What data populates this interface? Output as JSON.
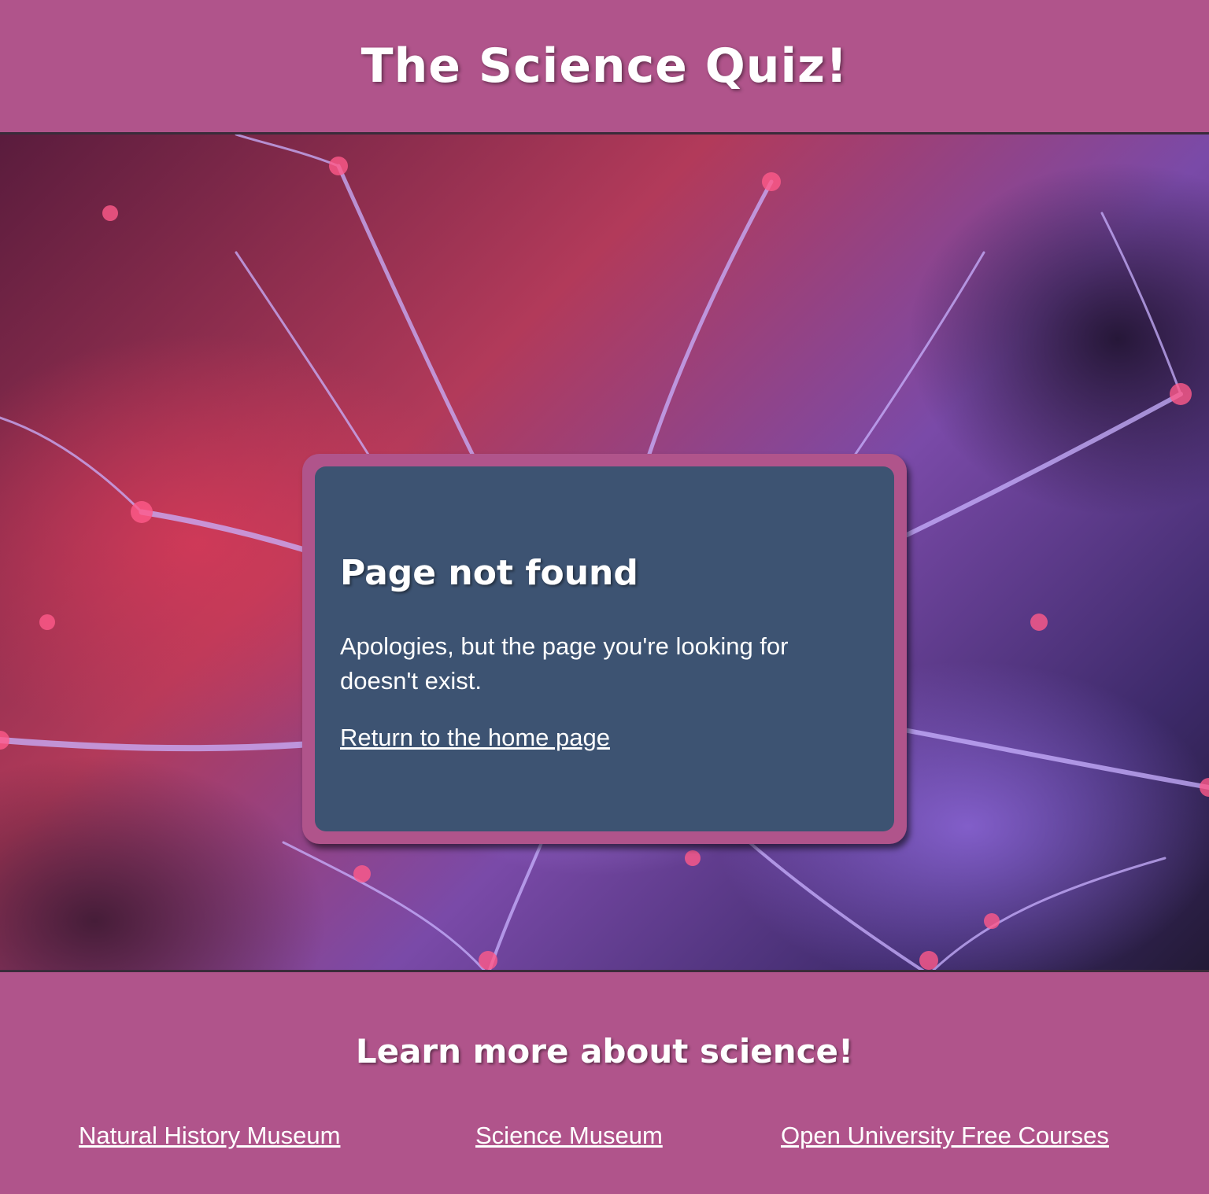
{
  "header": {
    "title": "The Science Quiz!"
  },
  "hero": {
    "image": "plasma-ball-background",
    "colors": {
      "accent": "#b0548b",
      "card": "#3d5372"
    }
  },
  "card": {
    "title": "Page not found",
    "message": "Apologies, but the page you're looking for doesn't exist.",
    "link_label": "Return to the home page"
  },
  "footer": {
    "heading": "Learn more about science!",
    "links": [
      {
        "label": "Natural History Museum"
      },
      {
        "label": "Science Museum"
      },
      {
        "label": "Open University Free Courses"
      }
    ]
  }
}
